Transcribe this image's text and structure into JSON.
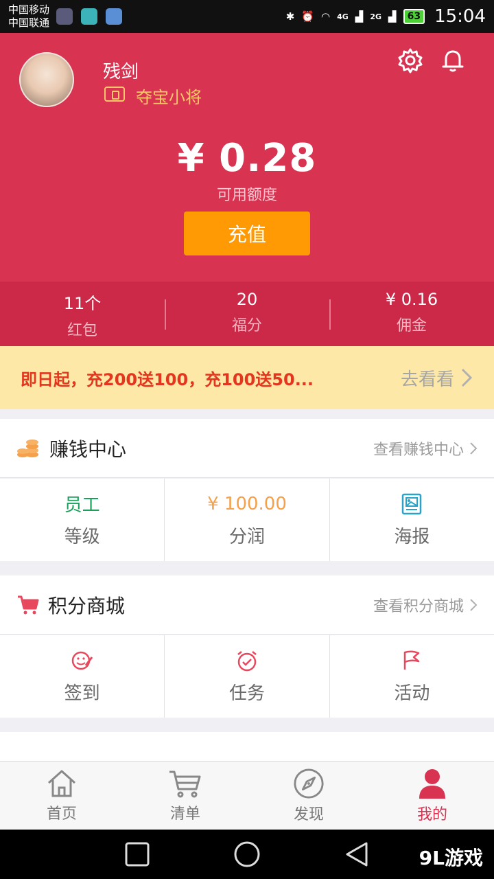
{
  "statusbar": {
    "carrier1": "中国移动",
    "carrier2": "中国联通",
    "net1": "4G",
    "net2": "2G",
    "battery": "63",
    "time": "15:04"
  },
  "profile": {
    "username": "残剑",
    "level": "夺宝小将"
  },
  "balance": {
    "amount": "¥ 0.28",
    "label": "可用额度",
    "recharge_label": "充值"
  },
  "stats": [
    {
      "value": "11个",
      "label": "红包"
    },
    {
      "value": "20",
      "label": "福分"
    },
    {
      "value": "¥ 0.16",
      "label": "佣金"
    }
  ],
  "promo": {
    "text": "即日起，充200送100，充100送50...",
    "link": "去看看"
  },
  "earn_center": {
    "title": "赚钱中心",
    "link": "查看赚钱中心",
    "cells": [
      {
        "top": "员工",
        "label": "等级"
      },
      {
        "top": "¥ 100.00",
        "label": "分润"
      },
      {
        "label": "海报"
      }
    ]
  },
  "points_mall": {
    "title": "积分商城",
    "link": "查看积分商城",
    "cells": [
      {
        "label": "签到"
      },
      {
        "label": "任务"
      },
      {
        "label": "活动"
      }
    ]
  },
  "bottom_nav": [
    {
      "label": "首页"
    },
    {
      "label": "清单"
    },
    {
      "label": "发现"
    },
    {
      "label": "我的"
    }
  ],
  "colors": {
    "brand": "#d93352",
    "accent": "#ff9a05",
    "gold": "#ffc76a",
    "green": "#1aa05a",
    "orange": "#f5a04a"
  },
  "watermark": "9L游戏"
}
